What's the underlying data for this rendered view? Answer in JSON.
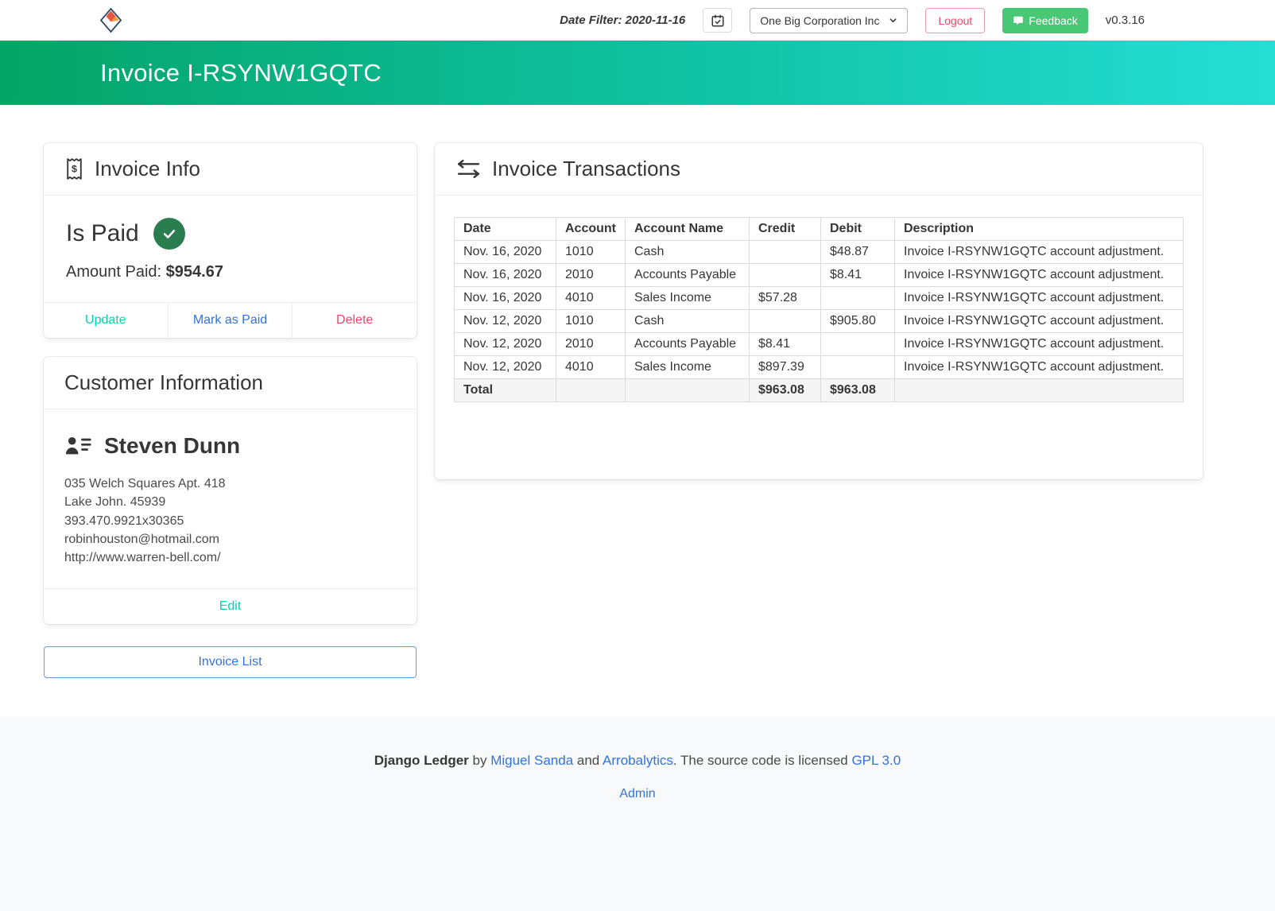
{
  "navbar": {
    "date_filter": "Date Filter: 2020-11-16",
    "entity": "One Big Corporation Inc",
    "logout": "Logout",
    "feedback": "Feedback",
    "version": "v0.3.16"
  },
  "hero": {
    "title": "Invoice I-RSYNW1GQTC"
  },
  "invoice_info": {
    "title": "Invoice Info",
    "status": "Is Paid",
    "amount_label": "Amount Paid:",
    "amount": "$954.67",
    "update": "Update",
    "mark_as_paid": "Mark as Paid",
    "delete": "Delete"
  },
  "customer": {
    "title": "Customer Information",
    "name": "Steven Dunn",
    "address1": "035 Welch Squares Apt. 418",
    "address2": "Lake John. 45939",
    "phone": "393.470.9921x30365",
    "email": "robinhouston@hotmail.com",
    "website": "http://www.warren-bell.com/",
    "edit": "Edit"
  },
  "invoice_list": "Invoice List",
  "transactions": {
    "title": "Invoice Transactions",
    "columns": [
      "Date",
      "Account",
      "Account Name",
      "Credit",
      "Debit",
      "Description"
    ],
    "rows": [
      {
        "date": "Nov. 16, 2020",
        "account": "1010",
        "account_name": "Cash",
        "credit": "",
        "debit": "$48.87",
        "description": "Invoice I-RSYNW1GQTC account adjustment."
      },
      {
        "date": "Nov. 16, 2020",
        "account": "2010",
        "account_name": "Accounts Payable",
        "credit": "",
        "debit": "$8.41",
        "description": "Invoice I-RSYNW1GQTC account adjustment."
      },
      {
        "date": "Nov. 16, 2020",
        "account": "4010",
        "account_name": "Sales Income",
        "credit": "$57.28",
        "debit": "",
        "description": "Invoice I-RSYNW1GQTC account adjustment."
      },
      {
        "date": "Nov. 12, 2020",
        "account": "1010",
        "account_name": "Cash",
        "credit": "",
        "debit": "$905.80",
        "description": "Invoice I-RSYNW1GQTC account adjustment."
      },
      {
        "date": "Nov. 12, 2020",
        "account": "2010",
        "account_name": "Accounts Payable",
        "credit": "$8.41",
        "debit": "",
        "description": "Invoice I-RSYNW1GQTC account adjustment."
      },
      {
        "date": "Nov. 12, 2020",
        "account": "4010",
        "account_name": "Sales Income",
        "credit": "$897.39",
        "debit": "",
        "description": "Invoice I-RSYNW1GQTC account adjustment."
      }
    ],
    "total": {
      "label": "Total",
      "credit": "$963.08",
      "debit": "$963.08"
    }
  },
  "footer": {
    "app": "Django Ledger",
    "by": " by ",
    "author": "Miguel Sanda",
    "and": " and ",
    "org": "Arrobalytics",
    "license_prefix": ". The source code is licensed ",
    "license": "GPL 3.0",
    "admin": "Admin"
  },
  "colors": {
    "hero_gradient_start": "#05a468",
    "hero_gradient_end": "#25ded4",
    "accent_teal": "#00d1b2",
    "link_blue": "#3273dc",
    "danger_red": "#f14668",
    "feedback_green": "#48c774",
    "paid_badge_green": "#2a7d4f"
  }
}
